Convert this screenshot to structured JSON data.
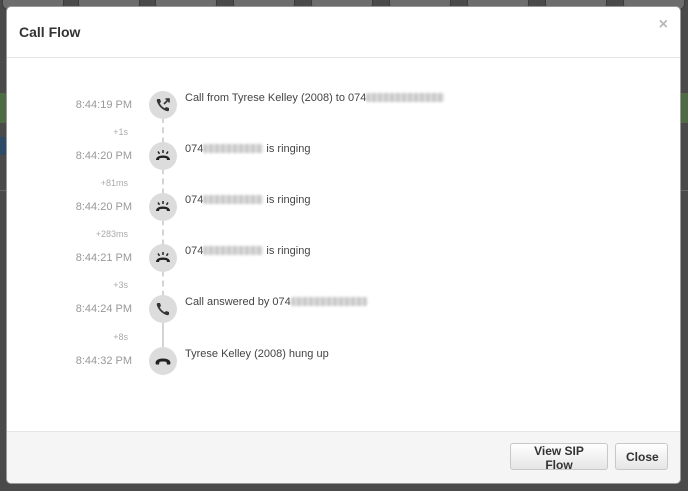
{
  "modal": {
    "title": "Call Flow",
    "close_glyph": "×"
  },
  "events": [
    {
      "time": "8:44:19 PM",
      "icon": "outgoing-call-icon",
      "text_prefix": "Call from Tyrese Kelley (2008) to 074",
      "text_suffix": ""
    },
    {
      "time": "8:44:20 PM",
      "icon": "ringing-phone-icon",
      "text_prefix": "074",
      "text_suffix": " is ringing"
    },
    {
      "time": "8:44:20 PM",
      "icon": "ringing-phone-icon",
      "text_prefix": "074",
      "text_suffix": " is ringing"
    },
    {
      "time": "8:44:21 PM",
      "icon": "ringing-phone-icon",
      "text_prefix": "074",
      "text_suffix": " is ringing"
    },
    {
      "time": "8:44:24 PM",
      "icon": "phone-answered-icon",
      "text_prefix": "Call answered by 074",
      "text_suffix": ""
    },
    {
      "time": "8:44:32 PM",
      "icon": "hang-up-icon",
      "text_prefix": "Tyrese Kelley (2008) hung up",
      "text_suffix": ""
    }
  ],
  "deltas": [
    "+1s",
    "+81ms",
    "+283ms",
    "+3s",
    "+8s"
  ],
  "footer": {
    "view_sip_label": "View SIP Flow",
    "close_label": "Close"
  },
  "colors": {
    "icon_bg": "#dcdcdc",
    "timeline": "#d4d4d4",
    "time_text": "#999999"
  }
}
